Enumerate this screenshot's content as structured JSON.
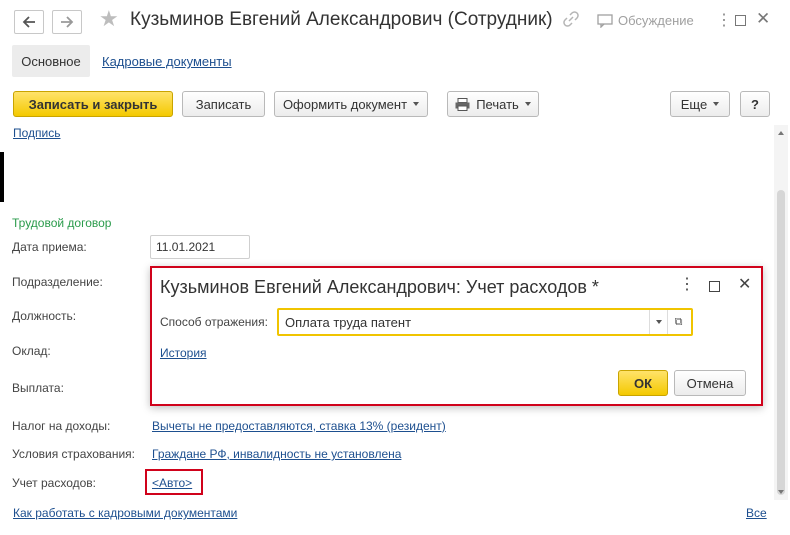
{
  "header": {
    "title": "Кузьминов Евгений Александрович (Сотрудник)",
    "discussion_label": "Обсуждение"
  },
  "tabs": {
    "main": "Основное",
    "hr_documents": "Кадровые документы"
  },
  "toolbar": {
    "save_close": "Записать и закрыть",
    "save": "Записать",
    "issue_document": "Оформить документ",
    "print": "Печать",
    "more": "Еще",
    "help": "?"
  },
  "signature_link": "Подпись",
  "form": {
    "section_title": "Трудовой договор",
    "hire_date_label": "Дата приема:",
    "hire_date_value": "11.01.2021",
    "department_label": "Подразделение:",
    "position_label": "Должность:",
    "salary_label": "Оклад:",
    "payment_label": "Выплата:",
    "income_tax_label": "Налог на доходы:",
    "income_tax_value": "Вычеты не предоставляются, ставка 13% (резидент)",
    "insurance_label": "Условия страхования:",
    "insurance_value": "Граждане РФ, инвалидность не установлена",
    "expense_label": "Учет расходов:",
    "expense_value": "<Авто>",
    "howto_link": "Как работать с кадровыми документами",
    "all_link": "Все"
  },
  "modal": {
    "title": "Кузьминов Евгений Александрович: Учет расходов *",
    "method_label": "Способ отражения:",
    "method_value": "Оплата труда патент",
    "history_link": "История",
    "ok": "ОК",
    "cancel": "Отмена"
  },
  "colors": {
    "accent_yellow": "#f4c900",
    "link_blue": "#1d4f8f",
    "section_green": "#2a9b4b",
    "highlight_red": "#d0021b"
  }
}
